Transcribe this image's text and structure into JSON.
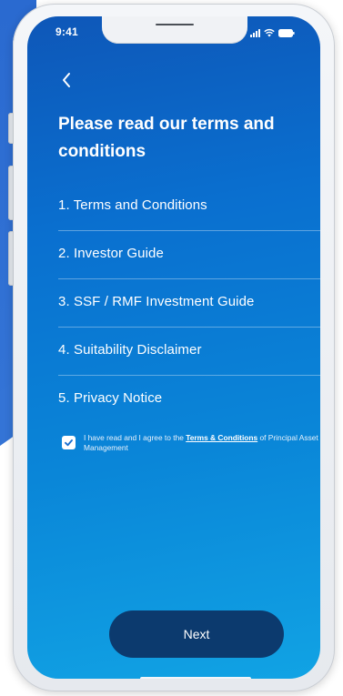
{
  "status_bar": {
    "time": "9:41",
    "icons": [
      "signal-icon",
      "wifi-icon",
      "battery-icon"
    ]
  },
  "header": {
    "back_icon": "chevron-left-icon",
    "title": "Please read our terms and conditions"
  },
  "documents": [
    {
      "label": "1. Terms and Conditions",
      "icon": "chevron-right-icon"
    },
    {
      "label": "2. Investor Guide",
      "icon": "chevron-right-icon"
    },
    {
      "label": "3. SSF / RMF Investment Guide",
      "icon": "chevron-right-icon"
    },
    {
      "label": "4. Suitability Disclaimer",
      "icon": "chevron-right-icon"
    },
    {
      "label": "5. Privacy Notice",
      "icon": "chevron-right-icon"
    }
  ],
  "agreement": {
    "checked": true,
    "text_before": "I have read and I agree to the ",
    "link_text": "Terms & Conditions",
    "text_after": " of Principal Asset Management"
  },
  "footer": {
    "next_label": "Next"
  },
  "colors": {
    "screen_gradient_top": "#0e57b8",
    "screen_gradient_bottom": "#11a3e4",
    "next_button": "#0c3a6e",
    "checkbox_check": "#1a6fd0",
    "background_band": "#2a6ad0"
  }
}
